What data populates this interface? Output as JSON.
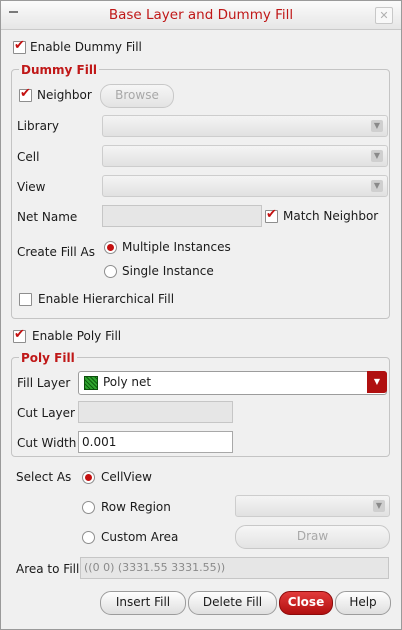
{
  "window": {
    "title": "Base Layer and Dummy Fill",
    "menu_glyph": "—",
    "close_glyph": "✕"
  },
  "enable_dummy_fill": {
    "label": "Enable Dummy Fill",
    "checked": true
  },
  "dummy_fill": {
    "title": "Dummy Fill",
    "neighbor": {
      "label": "Neighbor",
      "checked": true
    },
    "browse_label": "Browse",
    "library_label": "Library",
    "cell_label": "Cell",
    "view_label": "View",
    "net_name_label": "Net Name",
    "net_name_value": "",
    "match_neighbor": {
      "label": "Match Neighbor",
      "checked": true
    },
    "create_fill_as_label": "Create Fill As",
    "multiple_instances_label": "Multiple Instances",
    "single_instance_label": "Single Instance",
    "create_fill_as_selected": "Multiple Instances",
    "enable_hierarchical": {
      "label": "Enable Hierarchical Fill",
      "checked": false
    }
  },
  "enable_poly_fill": {
    "label": "Enable Poly Fill",
    "checked": true
  },
  "poly_fill": {
    "title": "Poly Fill",
    "fill_layer_label": "Fill Layer",
    "fill_layer_value": "Poly net",
    "cut_layer_label": "Cut Layer",
    "cut_layer_value": "",
    "cut_width_label": "Cut Width",
    "cut_width_value": "0.001"
  },
  "select_as": {
    "label": "Select As",
    "cellview_label": "CellView",
    "row_region_label": "Row Region",
    "custom_area_label": "Custom Area",
    "selected": "CellView",
    "draw_label": "Draw"
  },
  "area_to_fill": {
    "label": "Area to Fill",
    "value": "((0 0) (3331.55 3331.55))"
  },
  "buttons": {
    "insert_fill": "Insert Fill",
    "delete_fill": "Delete Fill",
    "close": "Close",
    "help": "Help"
  },
  "icons": {
    "check": "✔",
    "dropdown": "▼"
  },
  "colors": {
    "accent": "#c01818",
    "layer_swatch": "#1d8a1d"
  }
}
